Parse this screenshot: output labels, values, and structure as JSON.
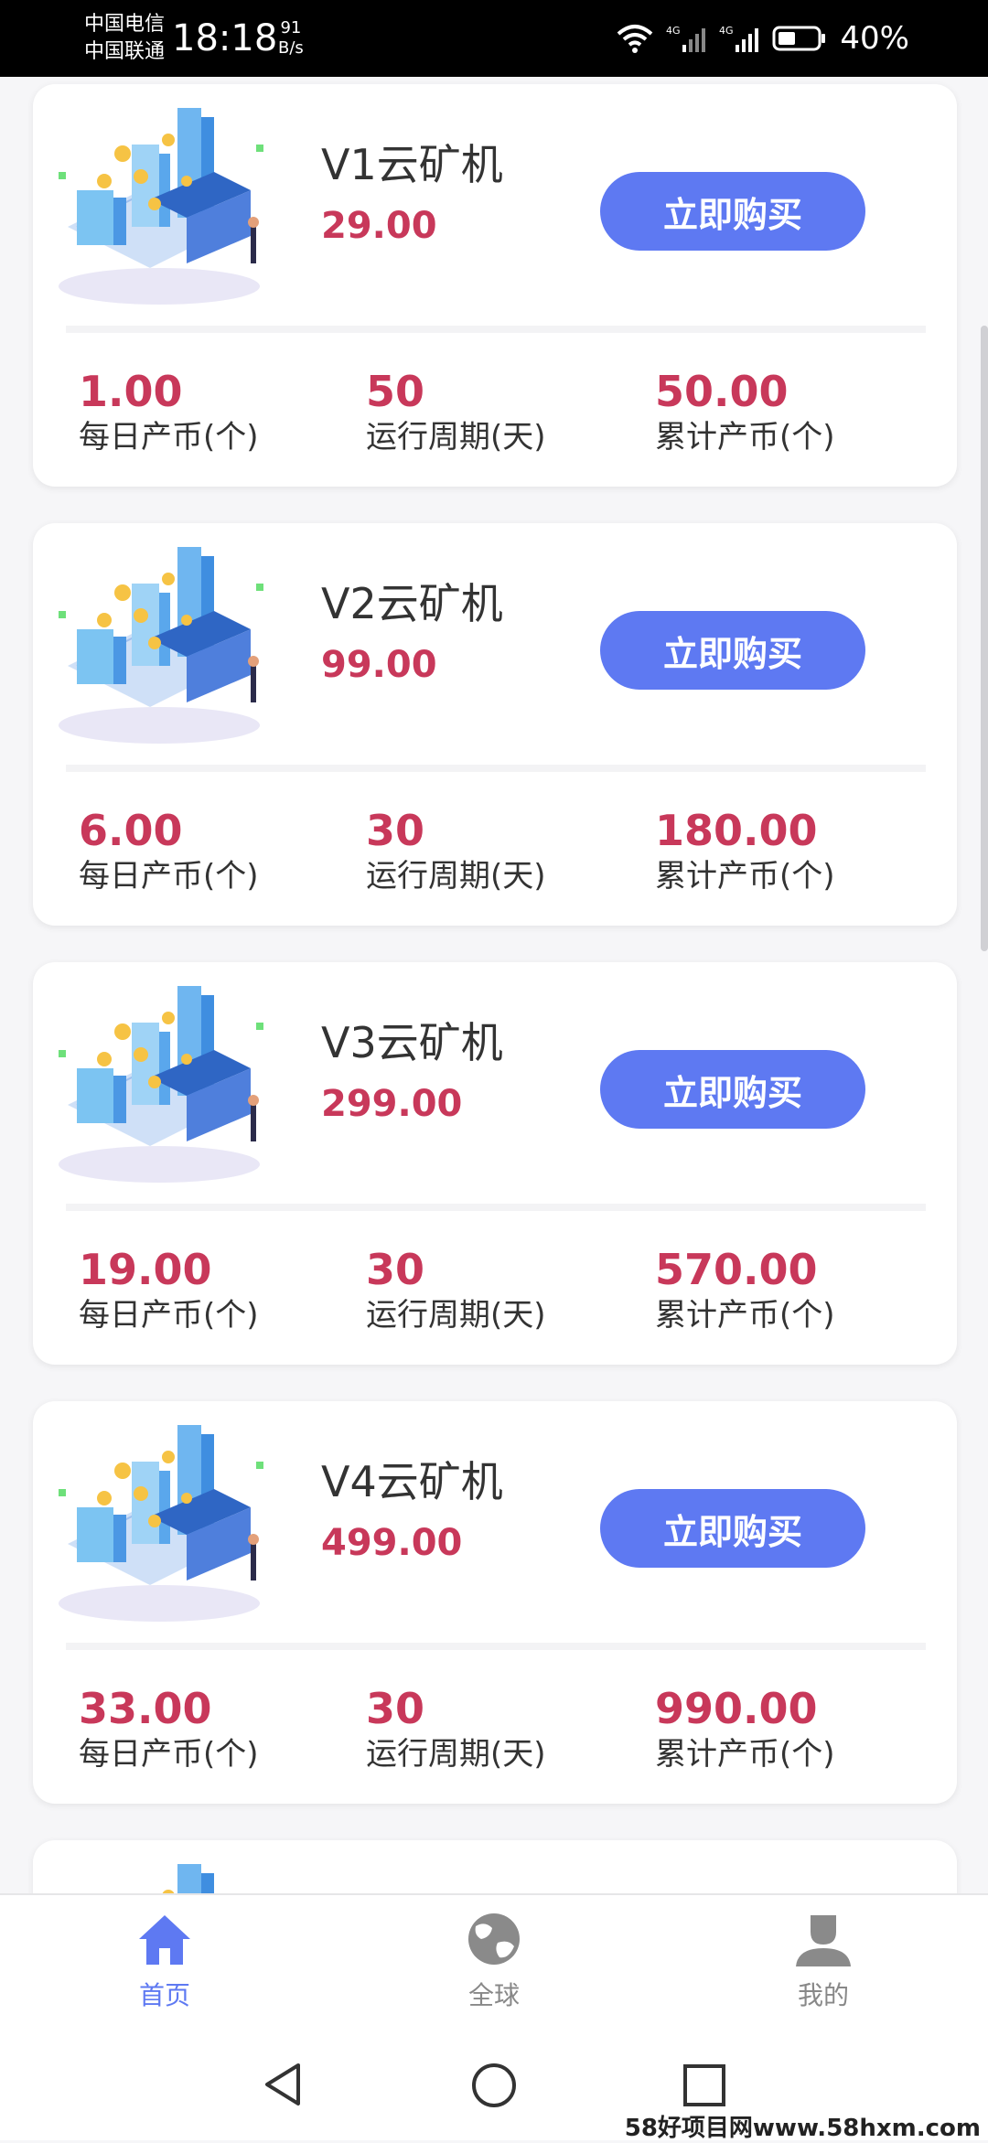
{
  "status": {
    "carrier1": "中国电信",
    "carrier2": "中国联通",
    "time": "18:18",
    "speed_value": "91",
    "speed_unit": "B/s",
    "battery": "40%"
  },
  "colors": {
    "accent": "#5e79f2",
    "price": "#c8385a"
  },
  "products": [
    {
      "name": "V1云矿机",
      "price": "29.00",
      "button": "立即购买",
      "daily": "1.00",
      "daily_label": "每日产币(个)",
      "period": "50",
      "period_label": "运行周期(天)",
      "total": "50.00",
      "total_label": "累计产币(个)"
    },
    {
      "name": "V2云矿机",
      "price": "99.00",
      "button": "立即购买",
      "daily": "6.00",
      "daily_label": "每日产币(个)",
      "period": "30",
      "period_label": "运行周期(天)",
      "total": "180.00",
      "total_label": "累计产币(个)"
    },
    {
      "name": "V3云矿机",
      "price": "299.00",
      "button": "立即购买",
      "daily": "19.00",
      "daily_label": "每日产币(个)",
      "period": "30",
      "period_label": "运行周期(天)",
      "total": "570.00",
      "total_label": "累计产币(个)"
    },
    {
      "name": "V4云矿机",
      "price": "499.00",
      "button": "立即购买",
      "daily": "33.00",
      "daily_label": "每日产币(个)",
      "period": "30",
      "period_label": "运行周期(天)",
      "total": "990.00",
      "total_label": "累计产币(个)"
    }
  ],
  "tabs": [
    {
      "label": "首页",
      "icon": "home-icon",
      "active": true
    },
    {
      "label": "全球",
      "icon": "globe-icon",
      "active": false
    },
    {
      "label": "我的",
      "icon": "profile-icon",
      "active": false
    }
  ],
  "watermark": "58好项目网www.58hxm.com"
}
